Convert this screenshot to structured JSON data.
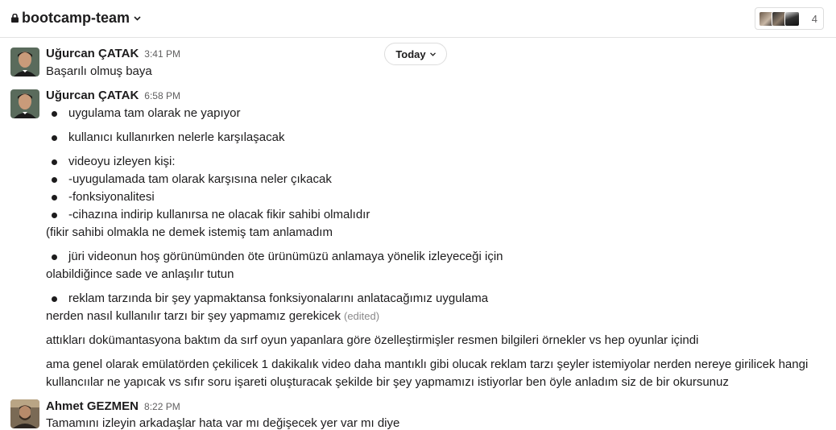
{
  "channel": {
    "name": "bootcamp-team",
    "member_count": "4"
  },
  "date_divider": "Today",
  "messages": [
    {
      "author": "Uğurcan ÇATAK",
      "time": "3:41 PM",
      "lines": [
        "Başarılı olmuş baya"
      ]
    },
    {
      "author": "Uğurcan ÇATAK",
      "time": "6:58 PM",
      "bullets": [
        "uygulama tam olarak ne yapıyor",
        "kullanıcı kullanırken nelerle karşılaşacak",
        "videoyu izleyen kişi:",
        "-uyugulamada tam olarak karşısına neler çıkacak",
        "-fonksiyonalitesi",
        "-cihazına indirip kullanırsa ne olacak fikir sahibi olmalıdır",
        "jüri videonun hoş görünümünden öte ürünümüzü anlamaya yönelik izleyeceği için",
        "reklam tarzında bir şey yapmaktansa fonksiyonalarını anlatacağımız uygulama"
      ],
      "plain": [
        "(fikir sahibi olmakla ne demek istemiş tam anlamadım",
        "olabildiğince sade ve anlaşılır tutun",
        "nerden nasıl kullanılır tarzı bir şey yapmamız gerekicek",
        "attıkları dokümantasyona baktım da sırf oyun yapanlara göre özelleştirmişler resmen bilgileri örnekler vs hep oyunlar içindi",
        "ama genel olarak emülatörden çekilicek 1 dakikalık video daha mantıklı gibi olucak reklam tarzı şeyler istemiyolar nerden nereye girilicek hangi",
        "kullancıılar ne yapıcak vs sıfır soru işareti oluşturacak şekilde bir şey yapmamızı istiyorlar ben öyle anladım siz de bir okursunuz"
      ],
      "edited_label": "(edited)"
    },
    {
      "author": "Ahmet GEZMEN",
      "time": "8:22 PM",
      "lines": [
        "Tamamını izleyin arkadaşlar hata var mı değişecek yer var mı diye"
      ]
    }
  ]
}
